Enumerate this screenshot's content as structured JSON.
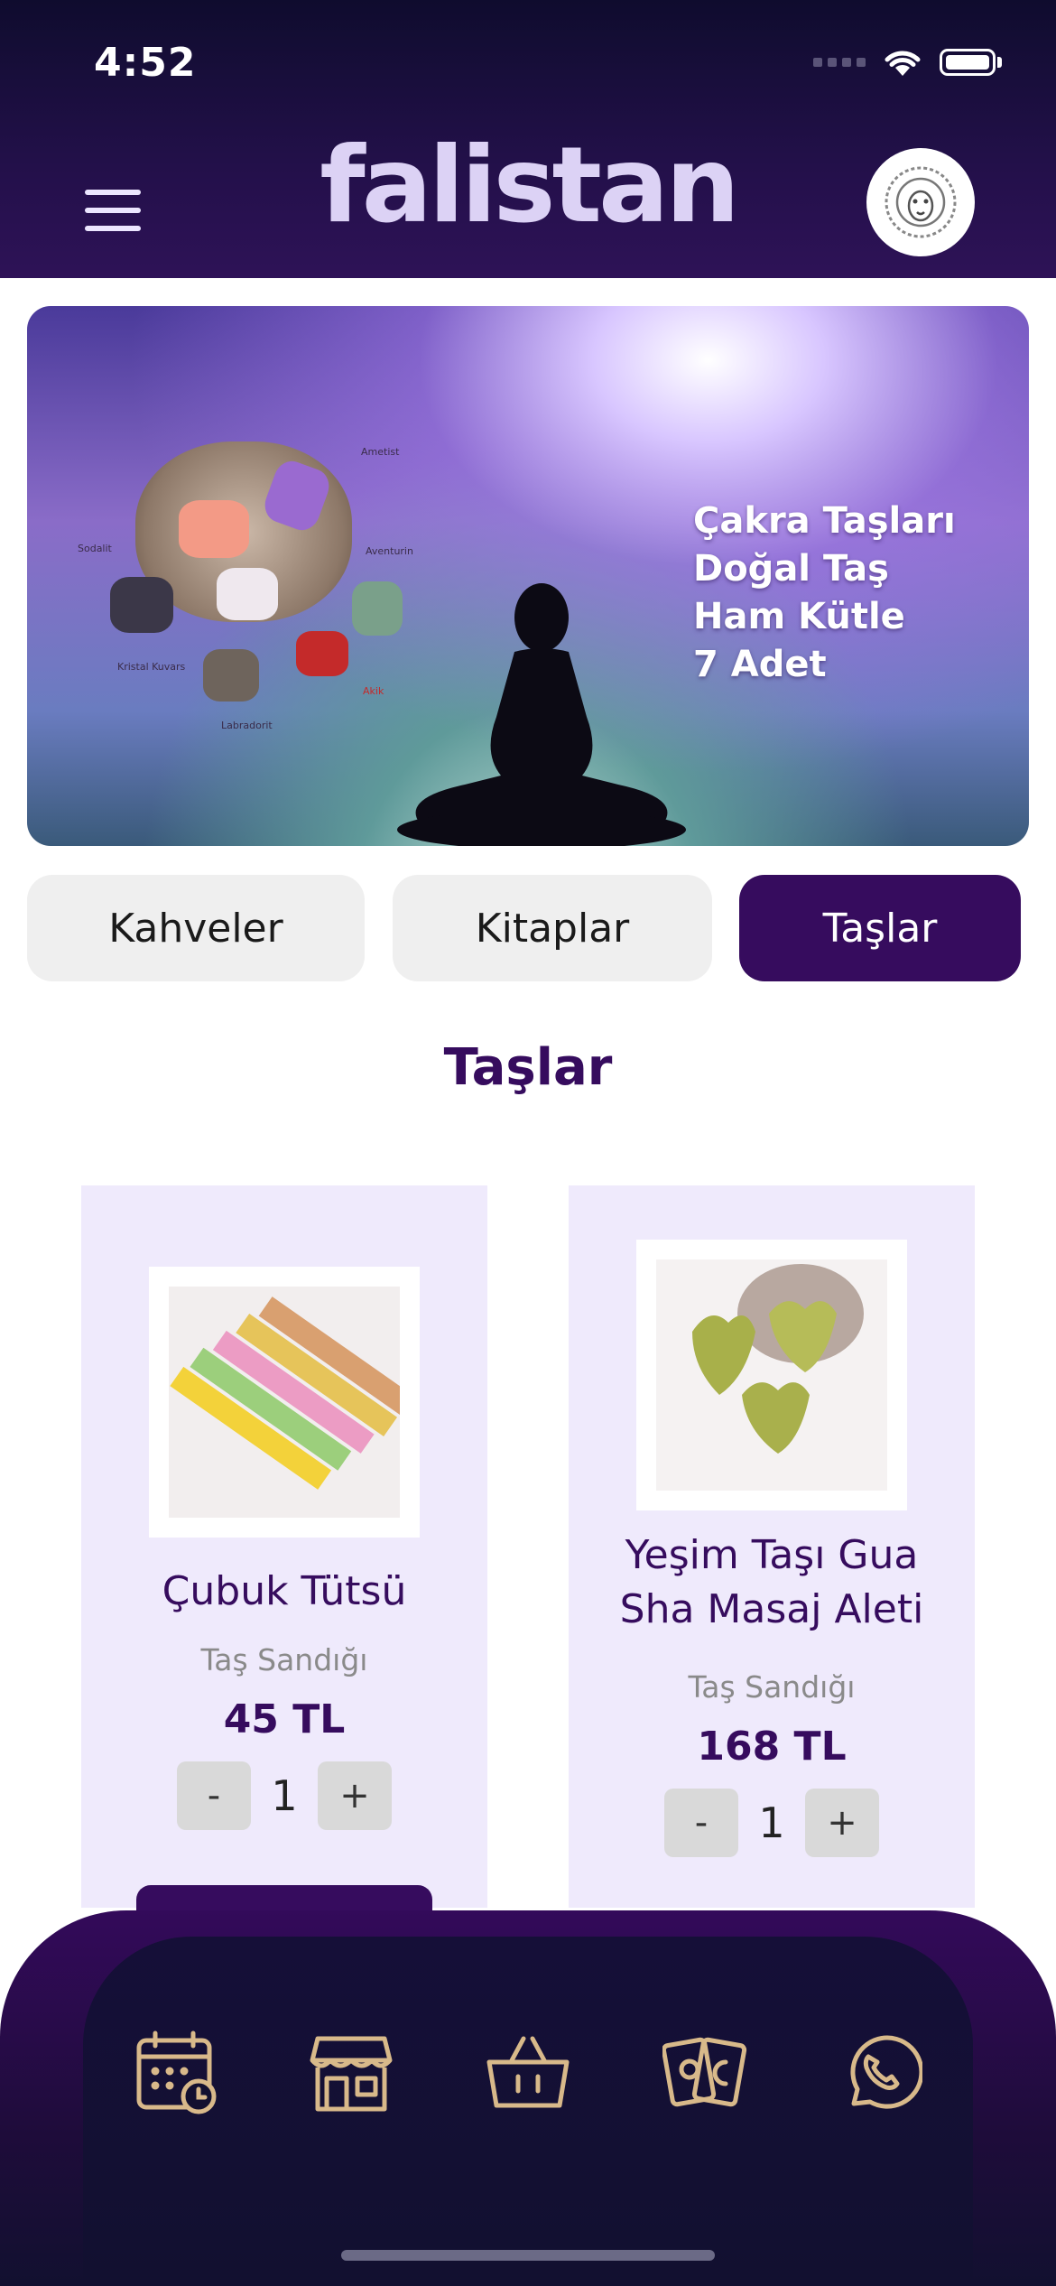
{
  "status_bar": {
    "time": "4:52"
  },
  "header": {
    "brand": "falistan"
  },
  "banner": {
    "lines": [
      "Çakra Taşları",
      "Doğal Taş",
      "Ham Kütle",
      "7 Adet"
    ],
    "stone_labels": [
      "Ametist",
      "Aventurin",
      "Akik",
      "Labradorit",
      "Kristal Kuvars",
      "Sodalit"
    ]
  },
  "tabs": [
    {
      "label": "Kahveler"
    },
    {
      "label": "Kitaplar"
    },
    {
      "label": "Taşlar",
      "active": true
    }
  ],
  "section": {
    "title": "Taşlar"
  },
  "products": [
    {
      "name": "Çubuk Tütsü",
      "brand": "Taş Sandığı",
      "price": "45 TL",
      "qty": "1"
    },
    {
      "name": "Yeşim Taşı Gua Sha Masaj Aleti",
      "name_lines": [
        "Yeşim Taşı Gua",
        "Sha Masaj Aleti"
      ],
      "brand": "Taş Sandığı",
      "price": "168 TL",
      "qty": "1"
    }
  ],
  "qty_controls": {
    "minus": "-",
    "plus": "+"
  },
  "bottom_nav": {
    "icons": [
      "calendar-clock-icon",
      "store-icon",
      "basket-icon",
      "tarot-cards-icon",
      "whatsapp-icon"
    ],
    "icon_color": "#d8b98a"
  },
  "colors": {
    "brand_purple": "#360c5e",
    "card_bg": "#efeafc"
  }
}
